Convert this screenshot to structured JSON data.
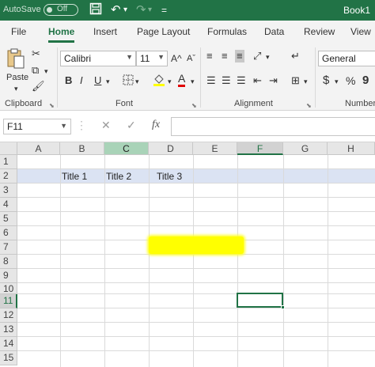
{
  "titlebar": {
    "autosave_label": "AutoSave",
    "toggle_state": "Off",
    "book_name": "Book1",
    "qat_more": "="
  },
  "tabs": [
    {
      "label": "File"
    },
    {
      "label": "Home"
    },
    {
      "label": "Insert"
    },
    {
      "label": "Page Layout"
    },
    {
      "label": "Formulas"
    },
    {
      "label": "Data"
    },
    {
      "label": "Review"
    },
    {
      "label": "View"
    }
  ],
  "ribbon": {
    "clipboard": {
      "label": "Clipboard",
      "paste_label": "Paste"
    },
    "font": {
      "label": "Font",
      "font_name": "Calibri",
      "font_size": "11",
      "bold": "B",
      "italic": "I",
      "underline": "U",
      "grow": "A^",
      "shrink": "Aˇ",
      "font_color": "A"
    },
    "alignment": {
      "label": "Alignment"
    },
    "number": {
      "label": "Number",
      "format": "General",
      "currency": "$",
      "percent": "%",
      "comma": "9"
    }
  },
  "formulabar": {
    "namebox_value": "F11",
    "fx_label": "fx",
    "value": ""
  },
  "sheet": {
    "columns": [
      "A",
      "B",
      "C",
      "D",
      "E",
      "F",
      "G",
      "H"
    ],
    "rows": [
      "1",
      "2",
      "3",
      "4",
      "5",
      "6",
      "7",
      "8",
      "9",
      "10",
      "11",
      "12",
      "13",
      "14",
      "15"
    ],
    "cells": {
      "b2": "Title 1",
      "c2": "Title 2",
      "d2": "Title 3"
    },
    "active_cell": "F11"
  },
  "colors": {
    "accent": "#217346",
    "highlight": "#ffff00",
    "band": "#dbe3f3"
  }
}
